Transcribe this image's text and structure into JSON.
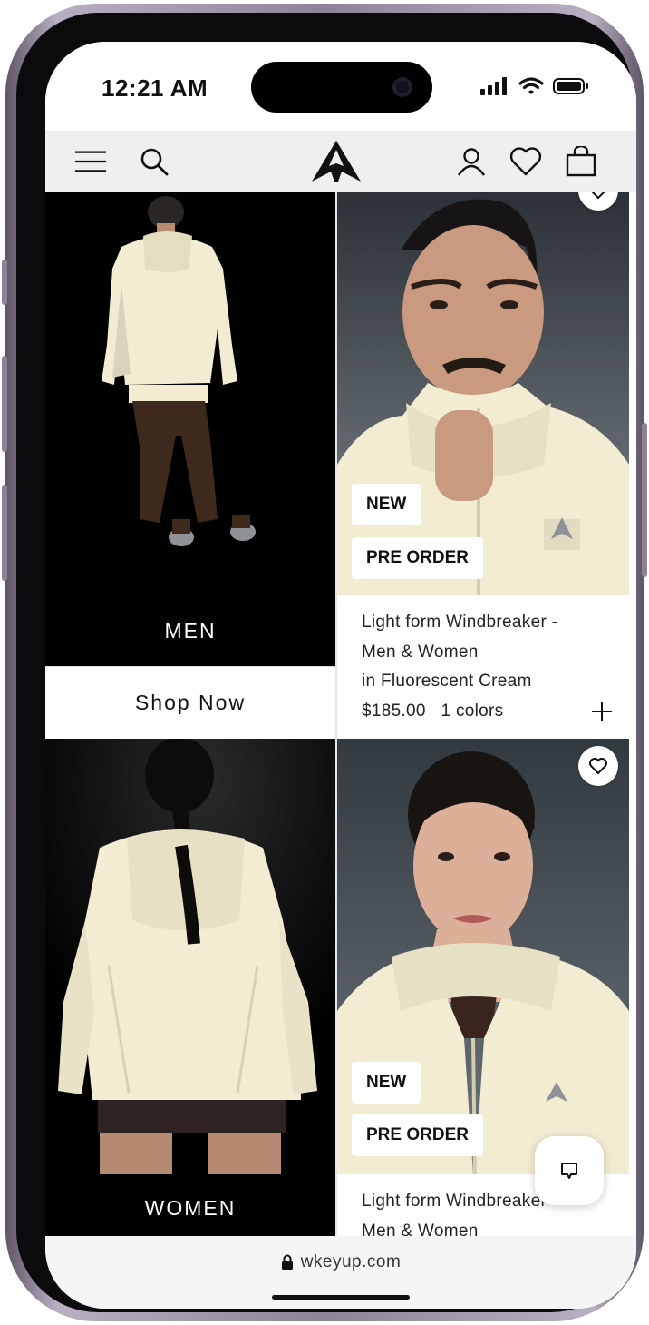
{
  "status_bar": {
    "time": "12:21 AM"
  },
  "nav": {
    "icons": [
      "menu-icon",
      "search-icon",
      "brand-logo",
      "account-icon",
      "wishlist-icon",
      "bag-icon"
    ]
  },
  "tiles": {
    "men": {
      "label": "MEN",
      "button": "Shop Now"
    },
    "women": {
      "label": "WOMEN"
    }
  },
  "products": [
    {
      "badges": [
        "NEW",
        "PRE ORDER"
      ],
      "title_line1": "Light form Windbreaker -",
      "title_line2": "Men & Women",
      "title_line3": "in Fluorescent Cream",
      "price": "$185.00",
      "colors": "1 colors"
    },
    {
      "badges": [
        "NEW",
        "PRE ORDER"
      ],
      "title_line1": "Light form Windbreaker -",
      "title_line2": "Men & Women"
    }
  ],
  "browser": {
    "url": "wkeyup.com"
  },
  "colors": {
    "nav_bg": "#efefef",
    "tile_bg": "#000000",
    "jacket": "#f1ecd2",
    "photo_bg": "#3b4248"
  }
}
